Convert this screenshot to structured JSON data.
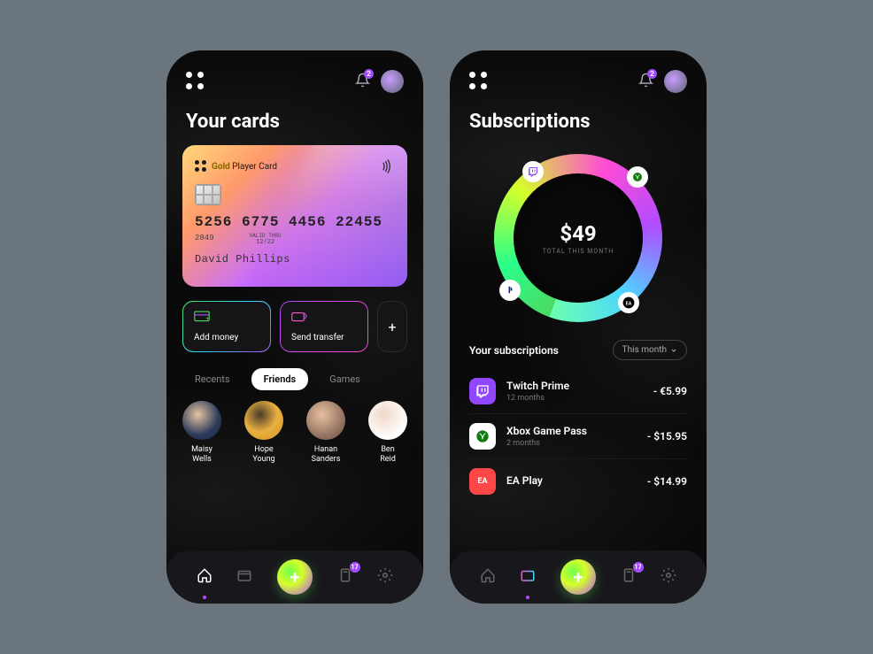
{
  "notifications": 2,
  "screen1": {
    "title": "Your cards",
    "card": {
      "brand_gold": "Gold",
      "brand_name": "Player Card",
      "number": "5256 6775 4456  22455",
      "small": "2849",
      "valid_label": "VALID THRU",
      "expiry": "12/22",
      "holder": "David Phillips"
    },
    "actions": {
      "add": "Add money",
      "send": "Send transfer"
    },
    "tabs": [
      "Recents",
      "Friends",
      "Games"
    ],
    "active_tab": 1,
    "friends": [
      {
        "name": "Maisy Wells"
      },
      {
        "name": "Hope Young"
      },
      {
        "name": "Hanan Sanders"
      },
      {
        "name": "Ben Reid"
      }
    ]
  },
  "screen2": {
    "title": "Subscriptions",
    "donut": {
      "amount": "$49",
      "label": "TOTAL THIS MONTH",
      "nodes": [
        "twitch",
        "xbox",
        "playstation",
        "ea"
      ]
    },
    "list_title": "Your subscriptions",
    "filter": "This month",
    "items": [
      {
        "name": "Twitch Prime",
        "duration": "12 months",
        "price": "- €5.99",
        "icon": "twitch"
      },
      {
        "name": "Xbox Game Pass",
        "duration": "2 months",
        "price": "- $15.95",
        "icon": "xbox"
      },
      {
        "name": "EA Play",
        "duration": "",
        "price": "- $14.99",
        "icon": "ea"
      }
    ]
  },
  "nav": {
    "badge": 17
  }
}
